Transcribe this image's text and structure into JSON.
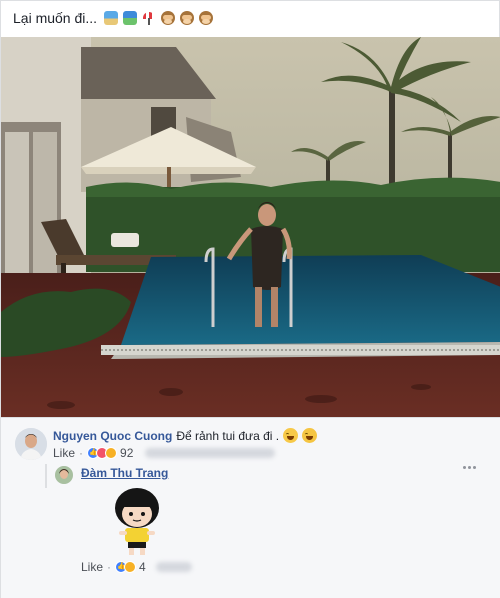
{
  "post": {
    "caption": "Lại muốn đi...",
    "caption_emoji": [
      "beach-icon",
      "island-icon",
      "umbrella-icon",
      "see-no-evil-monkey-icon",
      "see-no-evil-monkey-icon",
      "see-no-evil-monkey-icon"
    ]
  },
  "comments": [
    {
      "author": "Nguyen Quoc Cuong",
      "text": "Để rảnh tui đưa đi .",
      "text_emoji": [
        "grin-icon",
        "smile-icon"
      ],
      "like_label": "Like",
      "reactions": [
        "like-reaction-icon",
        "love-reaction-icon",
        "haha-reaction-icon"
      ],
      "reaction_count": "92"
    },
    {
      "author": "Đàm Thu Trang",
      "sticker": "cartoon-girl-sticker",
      "like_label": "Like",
      "reactions": [
        "like-reaction-icon",
        "haha-reaction-icon"
      ],
      "reaction_count": "4"
    }
  ],
  "colors": {
    "author_link": "#365899",
    "meta_text": "#90949c",
    "card_bg": "#ffffff",
    "comments_bg": "#f6f7f9"
  }
}
